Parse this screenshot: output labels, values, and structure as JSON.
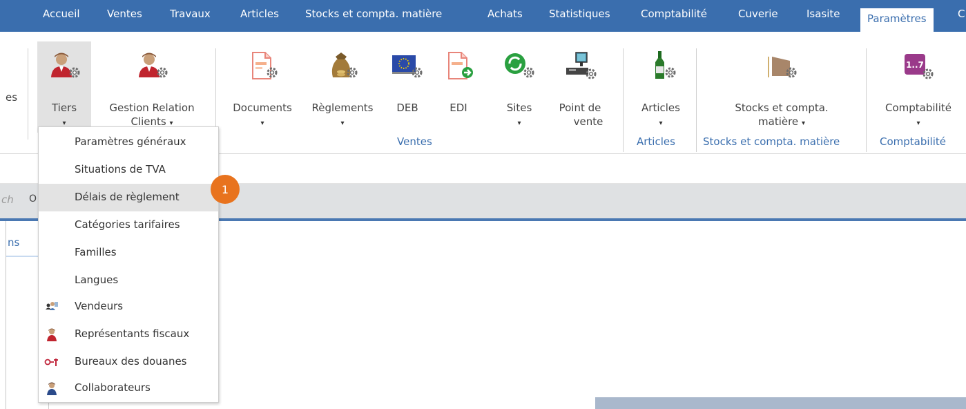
{
  "menu": {
    "items": [
      "Accueil",
      "Ventes",
      "Travaux",
      "Articles",
      "Stocks et compta. matière",
      "Achats",
      "Statistiques",
      "Comptabilité",
      "Cuverie",
      "Isasite",
      "Paramètres",
      "C"
    ],
    "active": "Paramètres"
  },
  "ribbon": {
    "partial_left": "es",
    "buttons": {
      "tiers": "Tiers",
      "grc_1": "Gestion Relation",
      "grc_2": "Clients",
      "documents": "Documents",
      "reglements": "Règlements",
      "deb": "DEB",
      "edi": "EDI",
      "sites": "Sites",
      "pdv_1": "Point de",
      "pdv_2": "vente",
      "articles": "Articles",
      "stocks_1": "Stocks et compta.",
      "stocks_2": "matière",
      "compta": "Comptabilité",
      "compta_icon_text": "1..7"
    },
    "groups": {
      "ventes": "Ventes",
      "articles": "Articles",
      "stocks": "Stocks et compta. matière",
      "compta": "Comptabilité"
    },
    "arrow": "▾"
  },
  "background": {
    "search_partial": "ch",
    "search_icon_glyph": "O",
    "tab_partial": "ns"
  },
  "dropdown": {
    "items": [
      {
        "label": "Paramètres généraux",
        "icon": ""
      },
      {
        "label": "Situations de TVA",
        "icon": ""
      },
      {
        "label": "Délais de règlement",
        "icon": "",
        "highlighted": true
      },
      {
        "label": "Catégories tarifaires",
        "icon": ""
      },
      {
        "label": "Familles",
        "icon": ""
      },
      {
        "label": "Langues",
        "icon": ""
      },
      {
        "label": "Vendeurs",
        "icon": "vendeurs-icon"
      },
      {
        "label": "Représentants fiscaux",
        "icon": "person-icon"
      },
      {
        "label": "Bureaux des douanes",
        "icon": "key-icon"
      },
      {
        "label": "Collaborateurs",
        "icon": "user-icon"
      }
    ]
  },
  "badge": {
    "number": "1"
  },
  "colors": {
    "menubar": "#3a6eae",
    "accent": "#3a6eae",
    "badge": "#e8731e",
    "highlight": "#e3e3e3"
  }
}
